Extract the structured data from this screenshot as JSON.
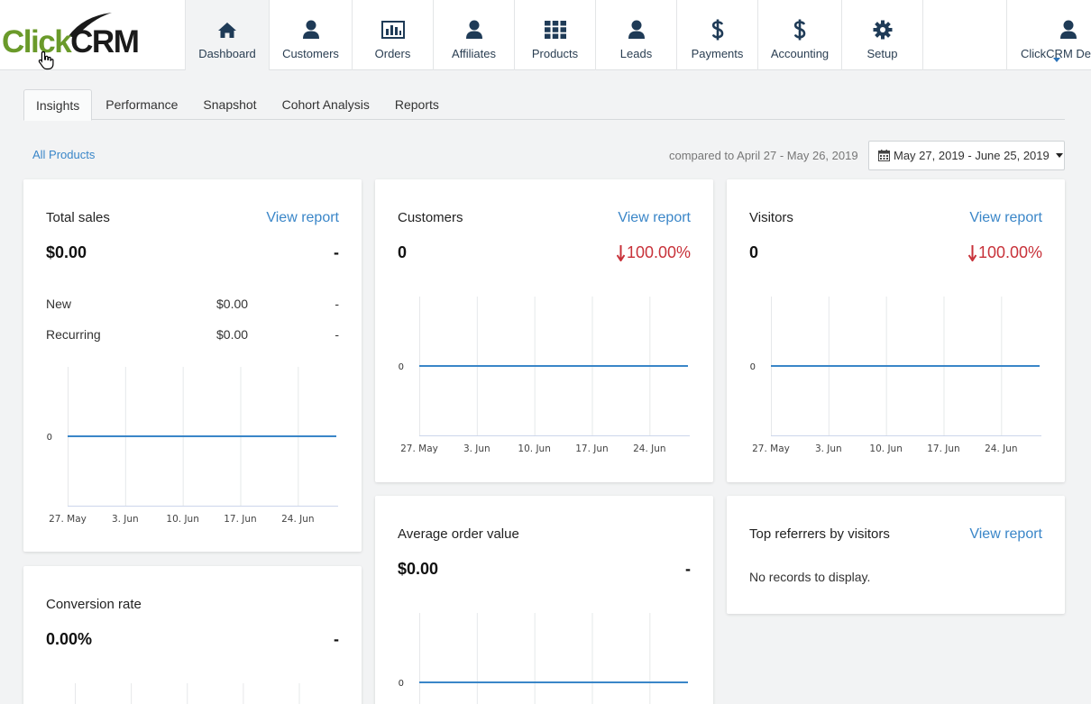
{
  "logo": {
    "part1": "Click",
    "part2": "CRM"
  },
  "nav": [
    {
      "label": "Dashboard",
      "icon": "home-icon",
      "active": true
    },
    {
      "label": "Customers",
      "icon": "user-icon"
    },
    {
      "label": "Orders",
      "icon": "bar-chart-icon"
    },
    {
      "label": "Affiliates",
      "icon": "user-icon"
    },
    {
      "label": "Products",
      "icon": "grid-icon"
    },
    {
      "label": "Leads",
      "icon": "user-icon"
    },
    {
      "label": "Payments",
      "icon": "dollar-icon"
    },
    {
      "label": "Accounting",
      "icon": "dollar-icon"
    },
    {
      "label": "Setup",
      "icon": "gear-icon"
    }
  ],
  "user": {
    "label": "ClickCRM Dev",
    "icon": "user-icon"
  },
  "subtabs": [
    "Insights",
    "Performance",
    "Snapshot",
    "Cohort Analysis",
    "Reports"
  ],
  "filter": {
    "products_link": "All Products",
    "compared": "compared to April 27 - May 26, 2019",
    "date_range": "May 27, 2019 - June 25, 2019"
  },
  "colors": {
    "accent": "#3a86c8",
    "nav_text": "#1f3b57",
    "down": "#c8323a",
    "series": "#3a86c8",
    "logo_green": "#6a9a2a"
  },
  "cards": {
    "total_sales": {
      "title": "Total sales",
      "link": "View report",
      "value": "$0.00",
      "change": "-",
      "rows": [
        {
          "label": "New",
          "value": "$0.00",
          "change": "-"
        },
        {
          "label": "Recurring",
          "value": "$0.00",
          "change": "-"
        }
      ]
    },
    "customers": {
      "title": "Customers",
      "link": "View report",
      "value": "0",
      "change": "100.00%"
    },
    "visitors": {
      "title": "Visitors",
      "link": "View report",
      "value": "0",
      "change": "100.00%"
    },
    "conversion_rate": {
      "title": "Conversion rate",
      "value": "0.00%",
      "change": "-"
    },
    "average_order_value": {
      "title": "Average order value",
      "value": "$0.00",
      "change": "-"
    },
    "top_referrers": {
      "title": "Top referrers by visitors",
      "link": "View report",
      "empty": "No records to display."
    }
  },
  "chart_data": [
    {
      "type": "line",
      "categories": [
        "27. May",
        "3. Jun",
        "10. Jun",
        "17. Jun",
        "24. Jun"
      ],
      "series": [
        {
          "values": [
            0,
            0,
            0,
            0,
            0
          ]
        }
      ],
      "y_tick": "0",
      "grid": true
    },
    {
      "type": "line",
      "categories": [
        "27. May",
        "3. Jun",
        "10. Jun",
        "17. Jun",
        "24. Jun"
      ],
      "series": [
        {
          "values": [
            0,
            0,
            0,
            0,
            0
          ]
        }
      ],
      "y_tick": "0",
      "grid": true
    },
    {
      "type": "line",
      "categories": [
        "27. May",
        "3. Jun",
        "10. Jun",
        "17. Jun",
        "24. Jun"
      ],
      "series": [
        {
          "values": [
            0,
            0,
            0,
            0,
            0
          ]
        }
      ],
      "y_tick": "0",
      "grid": true
    },
    {
      "type": "line",
      "categories": [],
      "series": [
        {
          "values": []
        }
      ],
      "y_tick": "",
      "grid": true
    },
    {
      "type": "line",
      "categories": [],
      "series": [
        {
          "values": [
            0,
            0,
            0,
            0,
            0
          ]
        }
      ],
      "y_tick": "0",
      "grid": true
    }
  ]
}
